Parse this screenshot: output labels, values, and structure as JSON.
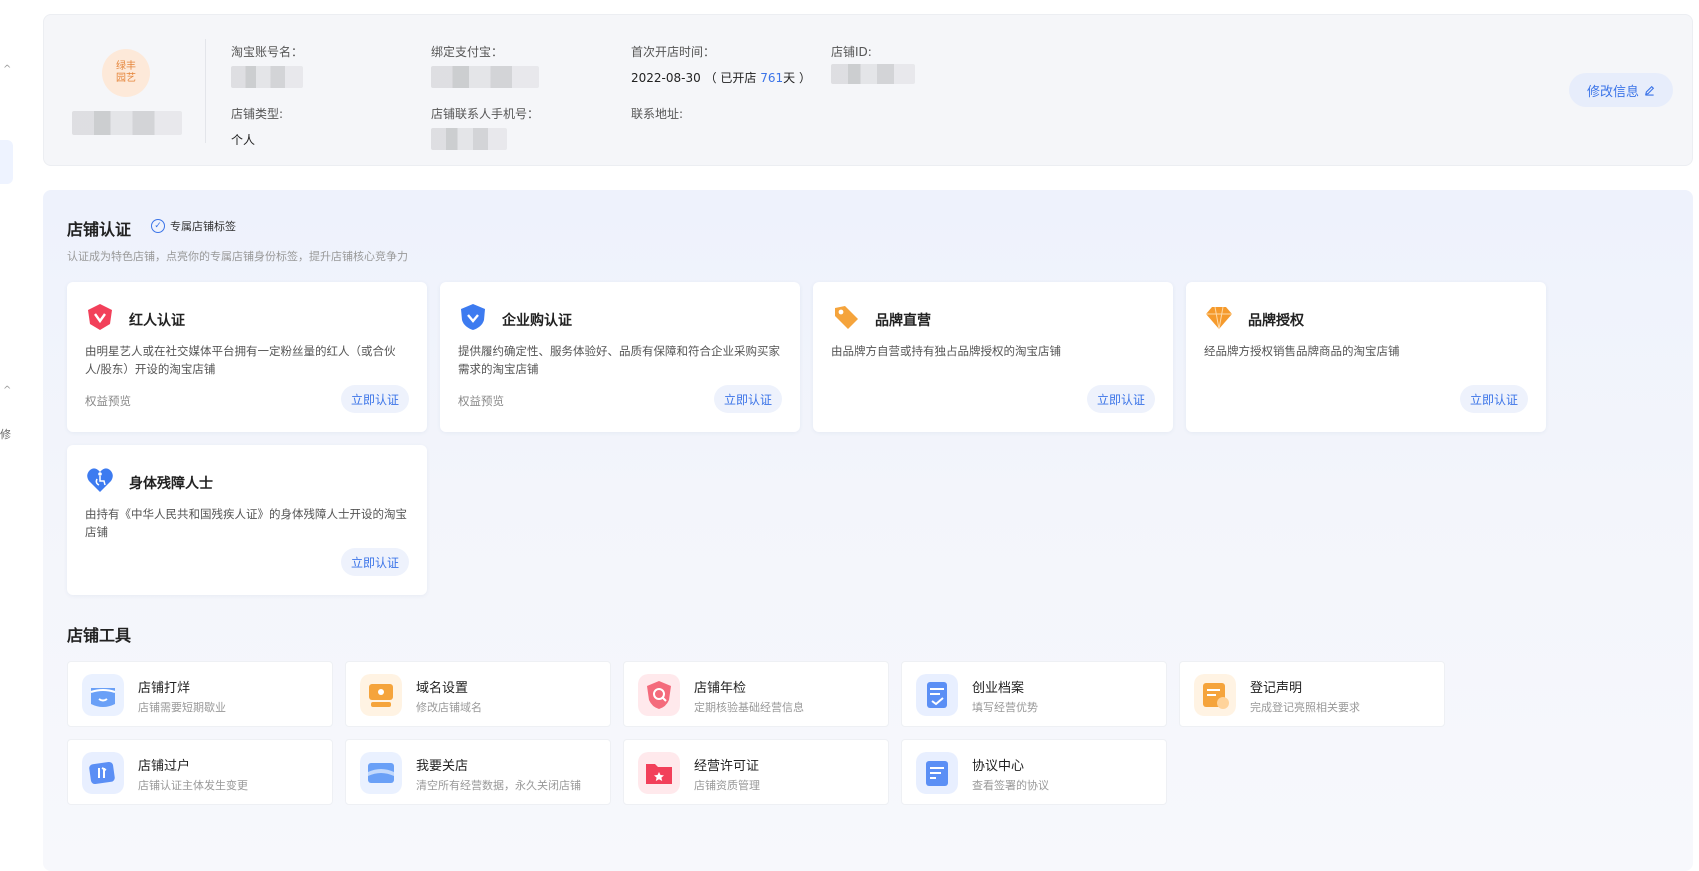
{
  "shop_info": {
    "logo_text": "绿丰\n园艺",
    "taobao_account_label": "淘宝账号名：",
    "alipay_label": "绑定支付宝：",
    "first_open_label": "首次开店时间：",
    "first_open_date": "2022-08-30",
    "open_prefix": "（ 已开店 ",
    "open_days": "761",
    "open_suffix": "天 ）",
    "shop_id_label": "店铺ID:",
    "shop_type_label": "店铺类型:",
    "shop_type_value": "个人",
    "contact_phone_label": "店铺联系人手机号：",
    "address_label": "联系地址:",
    "edit_button": "修改信息"
  },
  "certification": {
    "title": "店铺认证",
    "tag": "专属店铺标签",
    "subtitle": "认证成为特色店铺，点亮你的专属店铺身份标签，提升店铺核心竞争力",
    "cards": [
      {
        "title": "红人认证",
        "desc": "由明星艺人或在社交媒体平台拥有一定粉丝量的红人（或合伙人/股东）开设的淘宝店铺",
        "preview": "权益预览",
        "action": "立即认证",
        "icon": "red-shield-icon",
        "color": "#f2405a"
      },
      {
        "title": "企业购认证",
        "desc": "提供履约确定性、服务体验好、品质有保障和符合企业采购买家需求的淘宝店铺",
        "preview": "权益预览",
        "action": "立即认证",
        "icon": "blue-shield-icon",
        "color": "#3d7bf0"
      },
      {
        "title": "品牌直营",
        "desc": "由品牌方自营或持有独占品牌授权的淘宝店铺",
        "preview": "",
        "action": "立即认证",
        "icon": "orange-tag-icon",
        "color": "#f5a43c"
      },
      {
        "title": "品牌授权",
        "desc": "经品牌方授权销售品牌商品的淘宝店铺",
        "preview": "",
        "action": "立即认证",
        "icon": "orange-diamond-icon",
        "color": "#f59a2c"
      },
      {
        "title": "身体残障人士",
        "desc": "由持有《中华人民共和国残疾人证》的身体残障人士开设的淘宝店铺",
        "preview": "",
        "action": "立即认证",
        "icon": "accessibility-heart-icon",
        "color": "#3d7bf0"
      }
    ]
  },
  "tools": {
    "title": "店铺工具",
    "items": [
      {
        "title": "店铺打烊",
        "desc": "店铺需要短期歇业",
        "icon": "shop-close-icon",
        "color": "#6aa0f7"
      },
      {
        "title": "域名设置",
        "desc": "修改店铺域名",
        "icon": "domain-settings-icon",
        "color": "#f5a43c"
      },
      {
        "title": "店铺年检",
        "desc": "定期核验基础经营信息",
        "icon": "annual-check-icon",
        "color": "#f46b7c"
      },
      {
        "title": "创业档案",
        "desc": "填写经营优势",
        "icon": "startup-archive-icon",
        "color": "#5b8ff5"
      },
      {
        "title": "登记声明",
        "desc": "完成登记亮照相关要求",
        "icon": "registration-icon",
        "color": "#f5a43c"
      },
      {
        "title": "店铺过户",
        "desc": "店铺认证主体发生变更",
        "icon": "shop-transfer-icon",
        "color": "#5b8ff5"
      },
      {
        "title": "我要关店",
        "desc": "清空所有经营数据，永久关闭店铺",
        "icon": "shop-shutdown-icon",
        "color": "#6aa0f7"
      },
      {
        "title": "经营许可证",
        "desc": "店铺资质管理",
        "icon": "business-license-icon",
        "color": "#f2405a"
      },
      {
        "title": "协议中心",
        "desc": "查看签署的协议",
        "icon": "agreement-center-icon",
        "color": "#5b8ff5"
      }
    ]
  },
  "sidebar": {
    "caret": "^",
    "partial_text": "修"
  }
}
